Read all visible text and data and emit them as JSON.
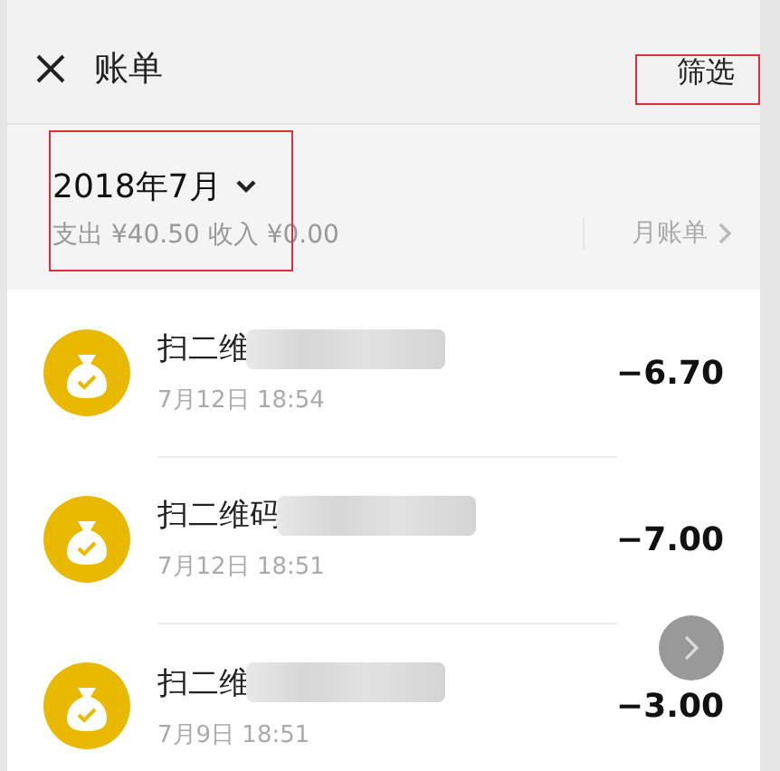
{
  "header": {
    "title": "账单",
    "filter_button": "筛选"
  },
  "summary": {
    "month": "2018年7月",
    "totals": "支出 ¥40.50 收入 ¥0.00",
    "monthly_bill_link": "月账单"
  },
  "transactions": [
    {
      "name": "扫二维",
      "blurred": true,
      "time": "7月12日 18:54",
      "amount": "−6.70"
    },
    {
      "name": "扫二维码",
      "blurred": true,
      "time": "7月12日 18:51",
      "amount": "−7.00"
    },
    {
      "name": "扫二维",
      "blurred": true,
      "time": "7月9日 18:51",
      "amount": "−3.00"
    }
  ],
  "annotations": [
    {
      "kind": "box"
    },
    {
      "kind": "box"
    }
  ]
}
